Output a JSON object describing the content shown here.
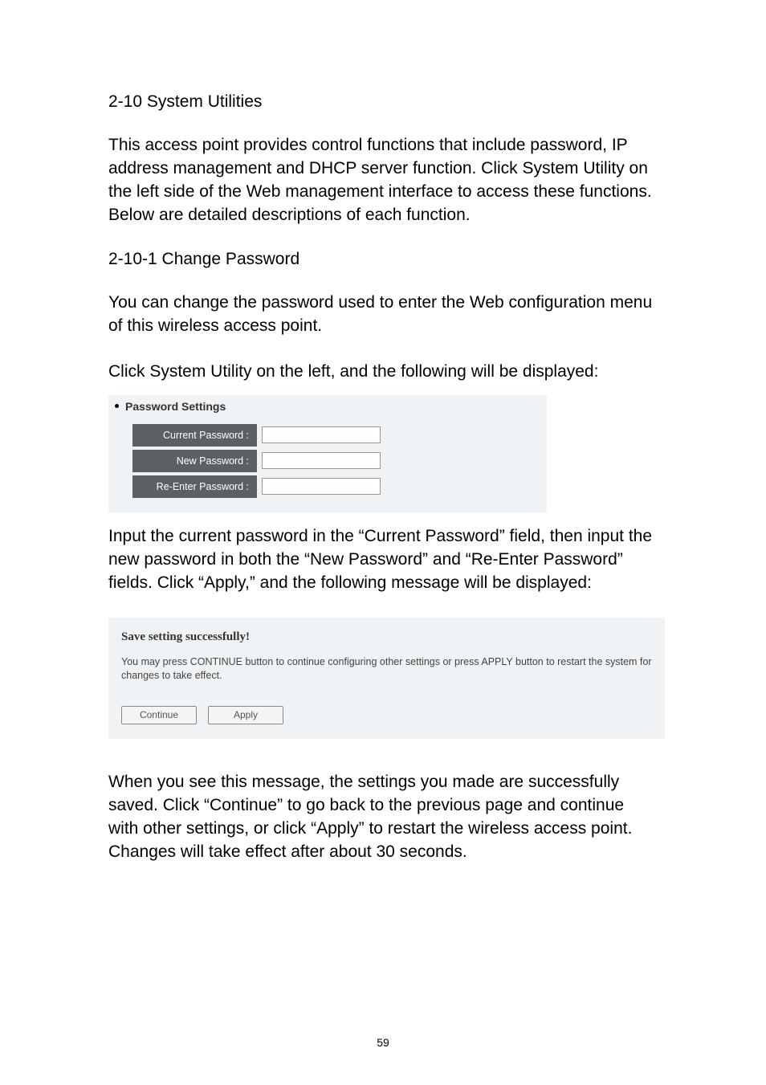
{
  "sections": {
    "s1_title": "2-10 System Utilities",
    "s1_para": "This access point provides control functions that include password, IP address management and DHCP server function. Click System Utility on the left side of the Web management interface to access these functions. Below are detailed descriptions of each function.",
    "s2_title": "2-10-1 Change Password",
    "s2_para1": "You can change the password used to enter the Web configuration menu of this wireless access point.",
    "s2_para2": "Click System Utility on the left, and the following will be displayed:"
  },
  "password_box": {
    "title": "Password Settings",
    "fields": [
      {
        "label": "Current Password :",
        "value": ""
      },
      {
        "label": "New Password :",
        "value": ""
      },
      {
        "label": "Re-Enter Password :",
        "value": ""
      }
    ]
  },
  "after_box_para": "Input the current password in the “Current Password” field, then input the new password in both the “New Password” and “Re-Enter Password” fields. Click “Apply,” and the following message will be displayed:",
  "save_box": {
    "title": "Save setting successfully!",
    "description": "You may press CONTINUE button to continue configuring other settings or press APPLY button to restart the system for changes to take effect.",
    "btn_continue": "Continue",
    "btn_apply": "Apply"
  },
  "final_para": "When you see this message, the settings you made are successfully saved. Click “Continue” to go back to the previous page and continue with other settings, or click “Apply” to restart the wireless access point. Changes will take effect after about 30 seconds.",
  "page_number": "59"
}
